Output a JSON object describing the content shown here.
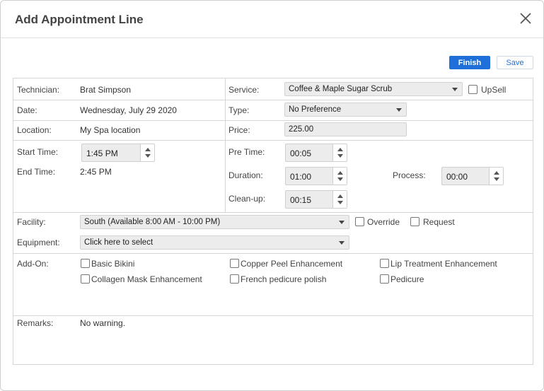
{
  "dialog": {
    "title": "Add Appointment Line"
  },
  "actions": {
    "finish_label": "Finish",
    "save_label": "Save"
  },
  "form": {
    "technician": {
      "label": "Technician:",
      "value": "Brat Simpson"
    },
    "date": {
      "label": "Date:",
      "value": "Wednesday, July 29 2020"
    },
    "location": {
      "label": "Location:",
      "value": "My Spa location"
    },
    "start_time": {
      "label": "Start Time:",
      "value": "1:45 PM"
    },
    "end_time": {
      "label": "End Time:",
      "value": "2:45 PM"
    },
    "service": {
      "label": "Service:",
      "value": "Coffee & Maple Sugar Scrub"
    },
    "upsell": {
      "label": "UpSell",
      "checked": false
    },
    "type": {
      "label": "Type:",
      "value": "No Preference"
    },
    "price": {
      "label": "Price:",
      "value": "225.00"
    },
    "pre_time": {
      "label": "Pre Time:",
      "value": "00:05"
    },
    "duration": {
      "label": "Duration:",
      "value": "01:00"
    },
    "process": {
      "label": "Process:",
      "value": "00:00"
    },
    "clean_up": {
      "label": "Clean-up:",
      "value": "00:15"
    },
    "facility": {
      "label": "Facility:",
      "value": "South (Available 8:00 AM - 10:00 PM)"
    },
    "override": {
      "label": "Override",
      "checked": false
    },
    "request": {
      "label": "Request",
      "checked": false
    },
    "equipment": {
      "label": "Equipment:",
      "value": "Click here to select"
    },
    "addon": {
      "label": "Add-On:",
      "items": [
        "Basic Bikini",
        "Copper Peel Enhancement",
        "Lip Treatment Enhancement",
        "Collagen Mask Enhancement",
        "French pedicure polish",
        "Pedicure"
      ]
    },
    "remarks": {
      "label": "Remarks:",
      "value": "No warning."
    }
  },
  "icons": {
    "close": "close-icon",
    "dropdown": "chevron-down-icon",
    "spinner_up": "caret-up-icon",
    "spinner_down": "caret-down-icon"
  },
  "colors": {
    "primary": "#1e6fd9",
    "field_bg": "#ececec",
    "border": "#d6d6d6"
  }
}
